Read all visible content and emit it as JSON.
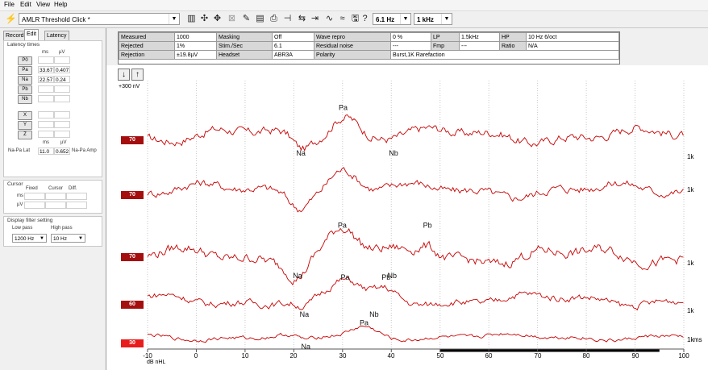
{
  "menu": {
    "items": [
      "File",
      "Edit",
      "View",
      "Help"
    ]
  },
  "toolbar": {
    "protocol": "AMLR Threshold Click *",
    "rate": "6.1 Hz",
    "freq": "1 kHz"
  },
  "left_tabs": [
    "Record",
    "Edit",
    "Latency"
  ],
  "latency": {
    "title": "Latency times",
    "col_ms": "ms",
    "col_uv": "µV",
    "buttons": [
      "P0",
      "Pa",
      "Na",
      "Pb",
      "Nb"
    ],
    "rows": [
      {
        "ms": "",
        "uv": ""
      },
      {
        "ms": "33.67",
        "uv": "0.407"
      },
      {
        "ms": "22.57",
        "uv": "0.24"
      },
      {
        "ms": "",
        "uv": ""
      },
      {
        "ms": "",
        "uv": ""
      }
    ],
    "xyz": [
      "X",
      "Y",
      "Z"
    ],
    "napa_label": "Na-Pa Lat",
    "napa_ms": "11.0",
    "napa_uv": "0.652",
    "napa_amp": "Na-Pa Amp",
    "ms2": "ms",
    "uv2": "µV"
  },
  "cursor": {
    "title": "Cursor",
    "fixed": "Fixed",
    "cursor": "Cursor",
    "diff": "Diff.",
    "ms": "ms",
    "uv": "µV"
  },
  "filter": {
    "title": "Display filter setting",
    "low_label": "Low pass",
    "high_label": "High pass",
    "low_value": "1200 Hz",
    "high_value": "10 Hz"
  },
  "info": {
    "rows": [
      [
        "Measured",
        "1000",
        "Masking",
        "Off",
        "Wave repro",
        "0 %",
        "LP",
        "1.5kHz",
        "HP",
        "10 Hz 6/oct"
      ],
      [
        "Rejected",
        "1%",
        "Stim./Sec",
        "6.1",
        "Residual noise",
        "---",
        "Fmp",
        "---",
        "Ratio",
        "N/A"
      ],
      [
        "Rejection",
        "±19.8µV",
        "Headset",
        "ABR3A",
        "Polarity",
        "Burst,1K Rarefaction",
        "",
        "",
        "",
        ""
      ]
    ]
  },
  "plot": {
    "scale": "+300 nV",
    "xunit": "ms",
    "xaxis_label": "dB nHL",
    "x_ticks": [
      "-10",
      "0",
      "10",
      "20",
      "30",
      "40",
      "50",
      "60",
      "70",
      "80",
      "90",
      "100"
    ],
    "traces": [
      {
        "level": "70",
        "freq": "1k",
        "selected": false,
        "peaks": [
          {
            "name": "Pa",
            "t": 30.2
          },
          {
            "name": "Na",
            "t": 21.5
          },
          {
            "name": "Nb",
            "t": 40.5
          }
        ]
      },
      {
        "level": "70",
        "freq": "1k",
        "selected": false,
        "peaks": []
      },
      {
        "level": "70",
        "freq": "1k",
        "selected": false,
        "peaks": [
          {
            "name": "Pa",
            "t": 30.0
          },
          {
            "name": "Na",
            "t": 20.8
          },
          {
            "name": "Nb",
            "t": 40.2
          },
          {
            "name": "Pb",
            "t": 47.5
          }
        ]
      },
      {
        "level": "60",
        "freq": "1k",
        "selected": false,
        "peaks": [
          {
            "name": "Pa",
            "t": 30.6
          },
          {
            "name": "Na",
            "t": 22.2
          },
          {
            "name": "Nb",
            "t": 36.5
          },
          {
            "name": "Pb",
            "t": 39.0
          }
        ]
      },
      {
        "level": "30",
        "freq": "1k",
        "selected": true,
        "peaks": [
          {
            "name": "Pa",
            "t": 34.5
          },
          {
            "name": "Na",
            "t": 22.5
          }
        ]
      }
    ]
  },
  "colors": {
    "trace": "#c80000",
    "level_bg": "#a40e0e",
    "level_sel": "#e81d1d"
  }
}
